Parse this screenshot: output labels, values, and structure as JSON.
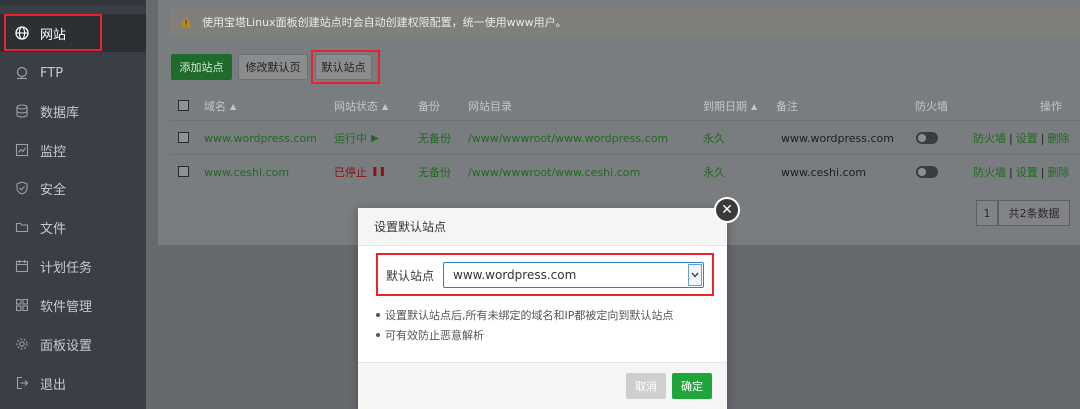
{
  "sidebar": {
    "items": [
      {
        "label": "网站",
        "icon": "globe-icon"
      },
      {
        "label": "FTP",
        "icon": "ftp-icon"
      },
      {
        "label": "数据库",
        "icon": "database-icon"
      },
      {
        "label": "监控",
        "icon": "monitor-icon"
      },
      {
        "label": "安全",
        "icon": "shield-icon"
      },
      {
        "label": "文件",
        "icon": "folder-icon"
      },
      {
        "label": "计划任务",
        "icon": "calendar-icon"
      },
      {
        "label": "软件管理",
        "icon": "apps-icon"
      },
      {
        "label": "面板设置",
        "icon": "gear-icon"
      },
      {
        "label": "退出",
        "icon": "logout-icon"
      }
    ]
  },
  "notice": {
    "text": "使用宝塔Linux面板创建站点时会自动创建权限配置，统一使用www用户。"
  },
  "toolbar": {
    "add_site": "添加站点",
    "edit_default_page": "修改默认页",
    "default_site": "默认站点"
  },
  "table": {
    "headers": {
      "domain": "域名",
      "status": "网站状态",
      "backup": "备份",
      "dir": "网站目录",
      "expiry": "到期日期",
      "note": "备注",
      "firewall": "防火墙",
      "ops": "操作"
    },
    "rows": [
      {
        "domain": "www.wordpress.com",
        "status": "运行中",
        "status_icon": "▶",
        "backup": "无备份",
        "dir": "/www/wwwroot/www.wordpress.com",
        "expiry": "永久",
        "note": "www.wordpress.com",
        "op_firewall": "防火墙",
        "op_settings": "设置",
        "op_delete": "删除",
        "sep": "|"
      },
      {
        "domain": "www.ceshi.com",
        "status": "已停止",
        "status_icon": "❚❚",
        "backup": "无备份",
        "dir": "/www/wwwroot/www.ceshi.com",
        "expiry": "永久",
        "note": "www.ceshi.com",
        "op_firewall": "防火墙",
        "op_settings": "设置",
        "op_delete": "删除",
        "sep": "|"
      }
    ]
  },
  "pager": {
    "current": "1",
    "total": "共2条数据"
  },
  "modal": {
    "title": "设置默认站点",
    "field_label": "默认站点",
    "selected": "www.wordpress.com",
    "notes": [
      "设置默认站点后,所有未绑定的域名和IP都被定向到默认站点",
      "可有效防止恶意解析"
    ],
    "cancel": "取消",
    "confirm": "确定",
    "close_glyph": "✕"
  },
  "colors": {
    "accent_green": "#20a53a",
    "highlight_red": "#e8232a",
    "select_border": "#2f80c4"
  }
}
